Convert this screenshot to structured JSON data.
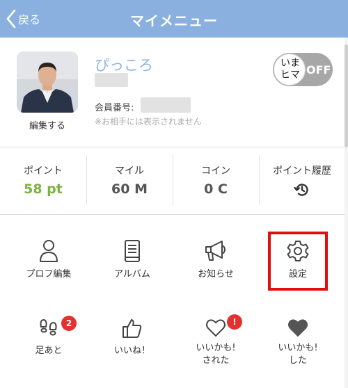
{
  "header": {
    "back_label": "戻る",
    "title": "マイメニュー"
  },
  "profile": {
    "username": "ぴっころ",
    "edit_label": "編集する",
    "member_label": "会員番号:",
    "note": "※お相手には表示されません",
    "toggle": {
      "knob_line1": "いま",
      "knob_line2": "ヒマ",
      "state_label": "OFF"
    }
  },
  "stats": [
    {
      "label": "ポイント",
      "value": "58 pt"
    },
    {
      "label": "マイル",
      "value": "60 M"
    },
    {
      "label": "コイン",
      "value": "0 C"
    },
    {
      "label": "ポイント履歴",
      "icon": "history-icon"
    }
  ],
  "menu_row1": [
    {
      "label": "プロフ編集",
      "icon": "person-icon"
    },
    {
      "label": "アルバム",
      "icon": "album-icon"
    },
    {
      "label": "お知らせ",
      "icon": "megaphone-icon"
    },
    {
      "label": "設定",
      "icon": "gear-icon"
    }
  ],
  "menu_row2": [
    {
      "label": "足あと",
      "icon": "footprints-icon",
      "badge": "2"
    },
    {
      "label": "いいね！",
      "icon": "thumbs-up-icon"
    },
    {
      "label_line1": "いいかも!",
      "label_line2": "された",
      "icon": "heart-outline-icon",
      "badge": "!"
    },
    {
      "label_line1": "いいかも!",
      "label_line2": "した",
      "icon": "heart-filled-icon"
    }
  ],
  "colors": {
    "header": "#8ab0df",
    "username": "#8cb4dc",
    "points": "#7cb342",
    "badge": "#e53030",
    "highlight": "#e01010"
  }
}
